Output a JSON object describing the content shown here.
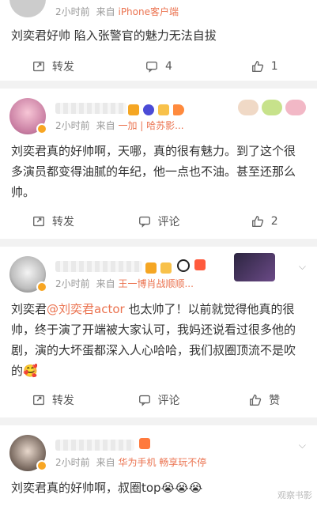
{
  "post1": {
    "time": "2小时前",
    "from_label": "来自",
    "source": "iPhone客户端",
    "text": "刘奕君好帅 陷入张警官的魅力无法自拔",
    "repost_label": "转发",
    "comment_count": "4",
    "like_count": "1"
  },
  "post2": {
    "time": "2小时前",
    "from_label": "来自",
    "source": "一加 | 哈苏影...",
    "text": "刘奕君真的好帅啊，天哪，真的很有魅力。到了这个很多演员都变得油腻的年纪，他一点也不油。甚至还那么帅。",
    "repost_label": "转发",
    "comment_label": "评论",
    "like_count": "2"
  },
  "post3": {
    "time": "2小时前",
    "from_label": "来自",
    "source": "王一博肖战顺顺...",
    "text_prefix": "刘奕君",
    "mention": "@刘奕君actor",
    "text_rest": " 也太帅了！以前就觉得他真的很帅，终于演了开端被大家认可，我妈还说看过很多他的剧，演的大坏蛋都深入人心哈哈，我们叔圈顶流不是吹的🥰",
    "repost_label": "转发",
    "comment_label": "评论",
    "like_label": "赞"
  },
  "post4": {
    "time": "2小时前",
    "from_label": "来自",
    "source": "华为手机 畅享玩不停",
    "text": "刘奕君真的好帅啊，叔圈top😭😭😭"
  },
  "watermark": "观察书影",
  "colors": {
    "accent": "#eb7350",
    "badge": "#f8a623"
  }
}
